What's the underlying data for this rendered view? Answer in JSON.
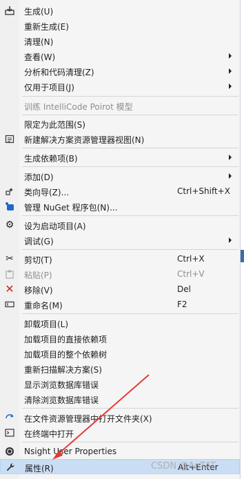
{
  "menu": {
    "items": [
      {
        "label": "生成(U)",
        "icon": "build-icon"
      },
      {
        "label": "重新生成(E)"
      },
      {
        "label": "清理(N)"
      },
      {
        "label": "查看(W)",
        "submenu": true
      },
      {
        "label": "分析和代码清理(Z)",
        "submenu": true
      },
      {
        "label": "仅用于项目(J)",
        "submenu": true
      },
      {
        "label": "训练 IntelliCode Poirot 模型",
        "disabled": true
      },
      {
        "label": "限定为此范围(S)"
      },
      {
        "label": "新建解决方案资源管理器视图(N)",
        "icon": "new-view-icon"
      },
      {
        "label": "生成依赖项(B)",
        "submenu": true
      },
      {
        "label": "添加(D)",
        "submenu": true
      },
      {
        "label": "类向导(Z)...",
        "shortcut": "Ctrl+Shift+X",
        "icon": "class-wizard-icon"
      },
      {
        "label": "管理 NuGet 程序包(N)...",
        "icon": "nuget-icon"
      },
      {
        "label": "设为启动项目(A)",
        "icon": "gear-icon"
      },
      {
        "label": "调试(G)",
        "submenu": true
      },
      {
        "label": "剪切(T)",
        "shortcut": "Ctrl+X",
        "icon": "scissors-icon"
      },
      {
        "label": "粘贴(P)",
        "shortcut": "Ctrl+V",
        "disabled": true,
        "icon": "paste-icon"
      },
      {
        "label": "移除(V)",
        "shortcut": "Del",
        "icon": "remove-icon"
      },
      {
        "label": "重命名(M)",
        "shortcut": "F2",
        "icon": "rename-icon"
      },
      {
        "label": "卸载项目(L)"
      },
      {
        "label": "加载项目的直接依赖项"
      },
      {
        "label": "加载项目的整个依赖树"
      },
      {
        "label": "重新扫描解决方案(S)"
      },
      {
        "label": "显示浏览数据库错误"
      },
      {
        "label": "清除浏览数据库错误"
      },
      {
        "label": "在文件资源管理器中打开文件夹(X)",
        "icon": "open-folder-icon"
      },
      {
        "label": "在终端中打开",
        "icon": "terminal-icon"
      },
      {
        "label": "Nsight User Properties",
        "icon": "nsight-icon"
      },
      {
        "label": "属性(R)",
        "shortcut": "Alt+Enter",
        "icon": "wrench-icon",
        "selected": true
      }
    ]
  },
  "watermark": "CSDN @AnTAT",
  "colors": {
    "menu_bg": "#f5f5f5",
    "selected_bg": "#c9def5",
    "annotation_arrow": "#e53935",
    "remove_icon": "#c42b1c"
  }
}
